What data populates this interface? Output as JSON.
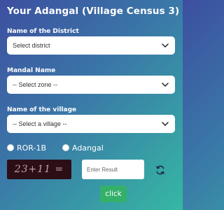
{
  "title": "Your Adangal (Village Census 3)",
  "district": {
    "label": "Name of the District",
    "selected": "Select district"
  },
  "mandal": {
    "label": "Mandal Name",
    "selected": "-- Select zone --"
  },
  "village": {
    "label": "Name of the village",
    "selected": "-- Select a village --"
  },
  "radios": [
    {
      "label": "ROR-1B",
      "checked": false
    },
    {
      "label": "Adangal",
      "checked": false
    }
  ],
  "captcha": {
    "text": "23+11 ="
  },
  "result": {
    "placeholder": "Enter Result",
    "value": ""
  },
  "submit": {
    "label": "click"
  },
  "icons": {
    "dropdown": "chevron-down-icon",
    "refresh": "refresh-icon"
  },
  "colors": {
    "submit_bg": "#34b06a",
    "captcha_bg": "#2c0e16"
  }
}
